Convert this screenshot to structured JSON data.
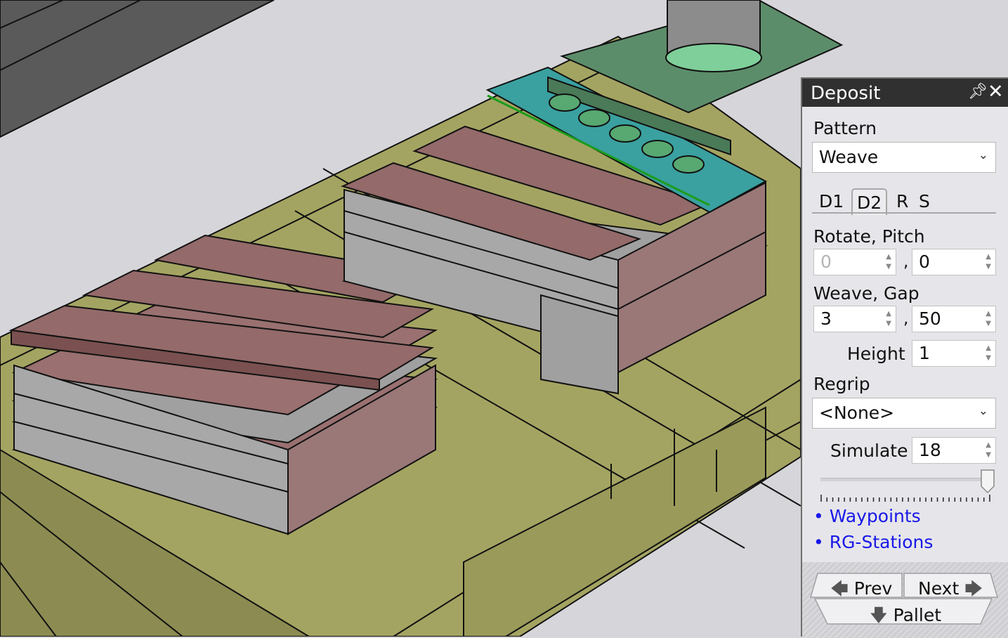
{
  "panel": {
    "title": "Deposit",
    "pattern_label": "Pattern",
    "pattern_value": "Weave",
    "tabs": [
      {
        "label": "D1",
        "active": false
      },
      {
        "label": "D2",
        "active": true
      },
      {
        "label": "R",
        "active": false
      },
      {
        "label": "S",
        "active": false
      }
    ],
    "rotate_pitch_label": "Rotate, Pitch",
    "rotate_value": "0",
    "pitch_value": "0",
    "weave_gap_label": "Weave, Gap",
    "weave_value": "3",
    "gap_value": "50",
    "height_label": "Height",
    "height_value": "1",
    "regrip_label": "Regrip",
    "regrip_value": "<None>",
    "simulate_label": "Simulate",
    "simulate_value": "18",
    "simulate_slider_fraction": 1.0,
    "links": [
      "• Waypoints",
      "• RG-Stations"
    ],
    "prev_label": "Prev",
    "next_label": "Next",
    "pallet_label": "Pallet",
    "separator": ","
  },
  "colors": {
    "panel_bg": "#e6e6ea",
    "titlebar": "#303030",
    "link": "#1818e8",
    "scene_bg": "#d6d6da",
    "pallet": "#a4a462",
    "box_top": "#946a6a",
    "gripper": "#3aa0a0",
    "arm": "#5c8d6a"
  },
  "icons": [
    "pin-icon",
    "close-icon",
    "chevron-down-icon",
    "arrow-left-icon",
    "arrow-right-icon",
    "arrow-down-icon"
  ]
}
